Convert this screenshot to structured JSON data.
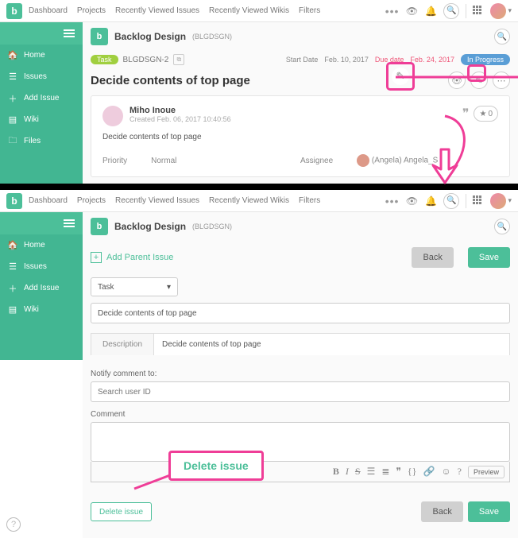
{
  "nav": {
    "dashboard": "Dashboard",
    "projects": "Projects",
    "recent_issues": "Recently Viewed Issues",
    "recent_wikis": "Recently Viewed Wikis",
    "filters": "Filters"
  },
  "sidebar": {
    "home": "Home",
    "issues": "Issues",
    "add_issue": "Add Issue",
    "wiki": "Wiki",
    "files": "Files"
  },
  "project": {
    "name": "Backlog Design",
    "code": "(BLGDSGN)"
  },
  "issue": {
    "type": "Task",
    "key": "BLGDSGN-2",
    "start_label": "Start Date",
    "start_date": "Feb. 10, 2017",
    "due_label": "Due date",
    "due_date": "Feb. 24, 2017",
    "status": "In Progress",
    "title": "Decide contents of top page",
    "author": "Miho Inoue",
    "created": "Created  Feb. 06, 2017 10:40:56",
    "desc": "Decide contents of top page",
    "star_count": "0",
    "priority_label": "Priority",
    "priority_value": "Normal",
    "assignee_label": "Assignee",
    "assignee_value": "(Angela) Angela_S"
  },
  "edit": {
    "add_parent": "Add Parent Issue",
    "back": "Back",
    "save": "Save",
    "type_select": "Task",
    "title_input": "Decide contents of top page",
    "desc_tab": "Description",
    "desc_value": "Decide contents of top page"
  },
  "notify": {
    "label": "Notify comment to:",
    "placeholder": "Search user ID",
    "comment_label": "Comment",
    "preview": "Preview",
    "delete_btn": "Delete issue",
    "delete_callout": "Delete issue",
    "back": "Back",
    "save": "Save"
  }
}
